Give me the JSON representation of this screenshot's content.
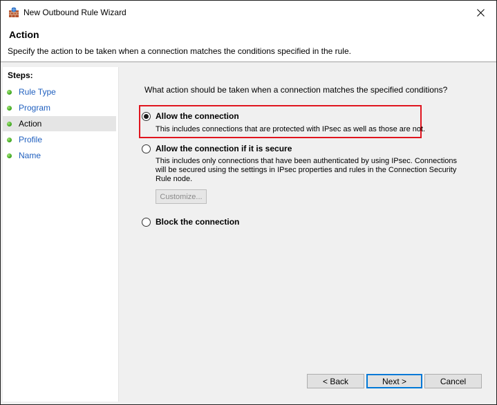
{
  "window": {
    "title": "New Outbound Rule Wizard",
    "icons": {
      "app": "firewall-shield-icon",
      "close": "close-icon"
    }
  },
  "header": {
    "title": "Action",
    "description": "Specify the action to be taken when a connection matches the conditions specified in the rule."
  },
  "steps": {
    "label": "Steps:",
    "items": [
      {
        "label": "Rule Type",
        "current": false
      },
      {
        "label": "Program",
        "current": false
      },
      {
        "label": "Action",
        "current": true
      },
      {
        "label": "Profile",
        "current": false
      },
      {
        "label": "Name",
        "current": false
      }
    ]
  },
  "main": {
    "question": "What action should be taken when a connection matches the specified conditions?",
    "options": [
      {
        "label": "Allow the connection",
        "description": "This includes connections that are protected with IPsec as well as those are not.",
        "selected": true
      },
      {
        "label": "Allow the connection if it is secure",
        "description_lines": [
          "This includes only connections that have been authenticated by using IPsec.  Connections",
          "will be secured using the settings in IPsec properties and rules in the Connection Security",
          "Rule node."
        ],
        "selected": false,
        "button": "Customize..."
      },
      {
        "label": "Block the connection",
        "selected": false
      }
    ],
    "highlight_color": "#e0141e"
  },
  "footer": {
    "back": "< Back",
    "next": "Next >",
    "cancel": "Cancel"
  }
}
